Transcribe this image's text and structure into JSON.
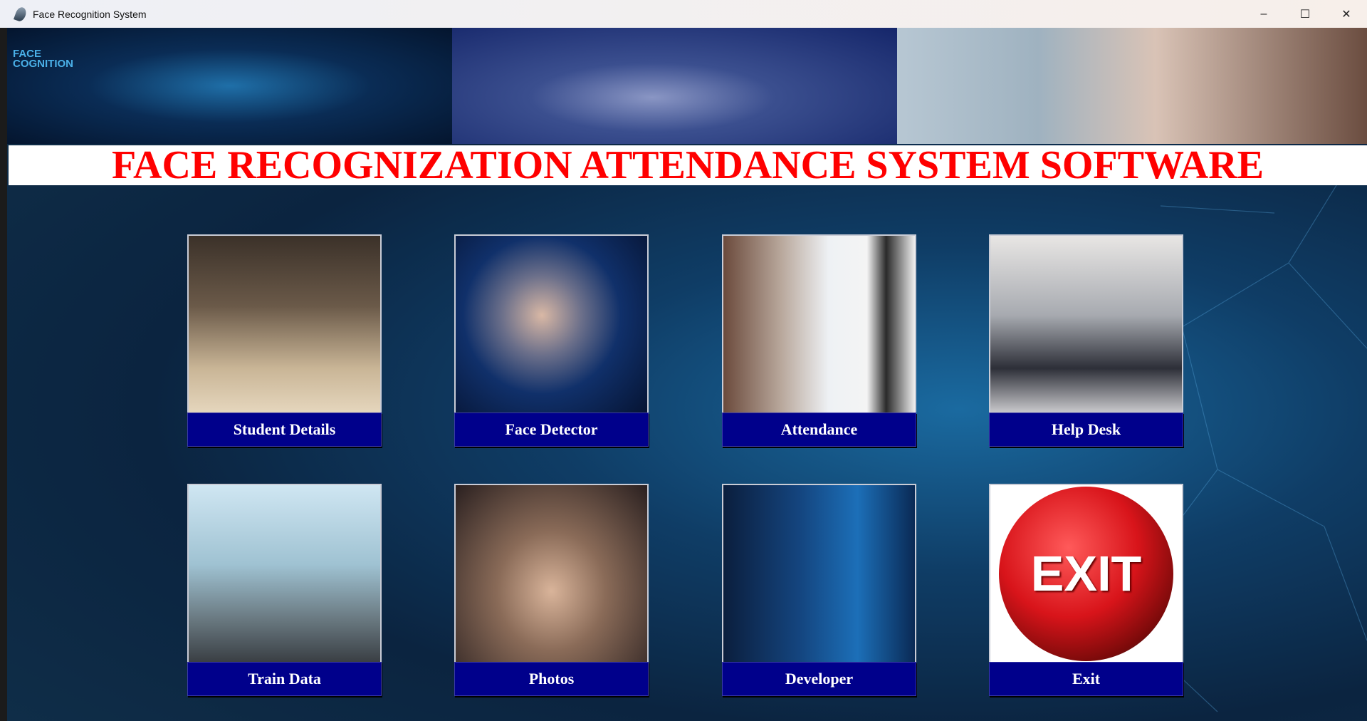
{
  "window": {
    "title": "Face Recognition System",
    "minimize": "–",
    "maximize": "☐",
    "close": "✕"
  },
  "banner": {
    "caption": "FACE\nCOGNITION"
  },
  "headline": "FACE RECOGNIZATION ATTENDANCE SYSTEM SOFTWARE",
  "tiles": [
    {
      "label": "Student Details"
    },
    {
      "label": "Face Detector"
    },
    {
      "label": "Attendance"
    },
    {
      "label": "Help Desk"
    },
    {
      "label": "Train Data"
    },
    {
      "label": "Photos"
    },
    {
      "label": "Developer"
    },
    {
      "label": "Exit"
    }
  ],
  "exit_image_text": "EXIT"
}
